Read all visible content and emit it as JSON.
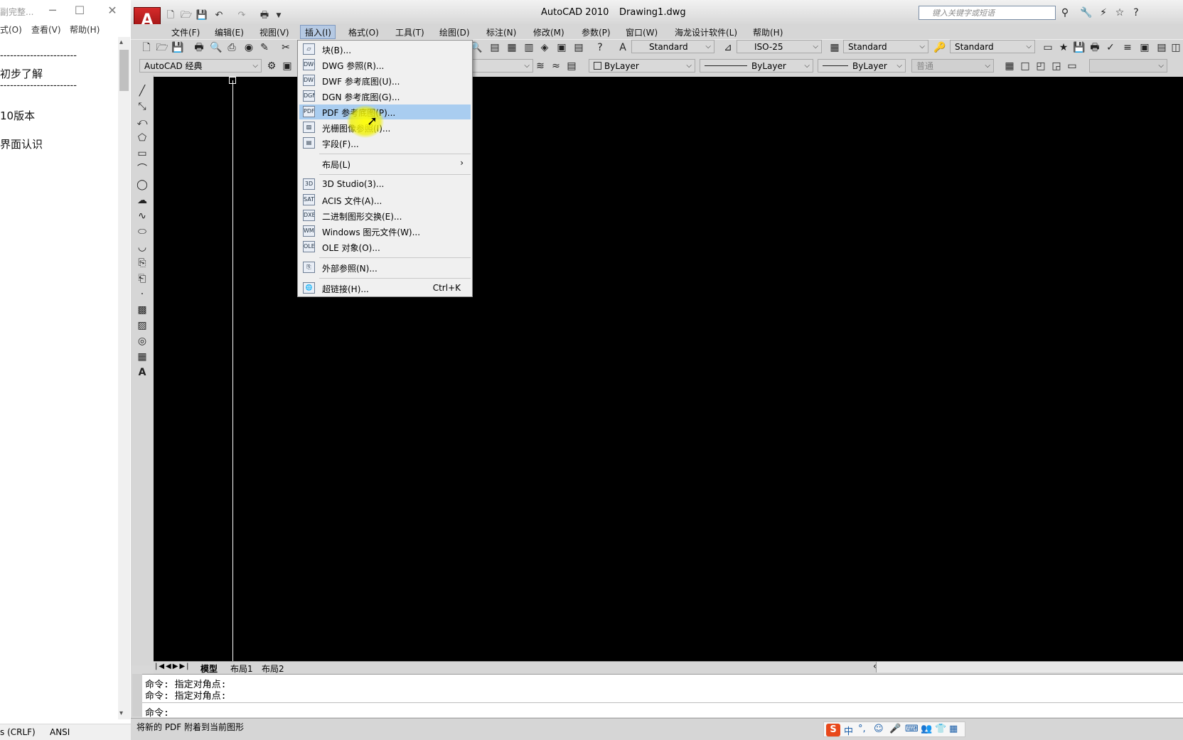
{
  "notepad": {
    "title": "副完整...",
    "menu": [
      "式(O)",
      "查看(V)",
      "帮助(H)"
    ],
    "lines": [
      "-----------------------",
      "初步了解",
      "-----------------------",
      "10版本",
      "界面认识"
    ],
    "status": [
      "s (CRLF)",
      "ANSI"
    ]
  },
  "autocad": {
    "title": "AutoCAD 2010",
    "file": "Drawing1.dwg",
    "search_placeholder": "键入关键字或短语",
    "menus": [
      "文件(F)",
      "编辑(E)",
      "视图(V)",
      "插入(I)",
      "格式(O)",
      "工具(T)",
      "绘图(D)",
      "标注(N)",
      "修改(M)",
      "参数(P)",
      "窗口(W)",
      "海龙设计软件(L)",
      "帮助(H)"
    ],
    "toolbar": {
      "text_style": "Standard",
      "dim_style": "ISO-25",
      "table_style": "Standard",
      "mleader_style": "Standard",
      "workspace": "AutoCAD 经典",
      "layer": "ByLayer",
      "linetype": "ByLayer",
      "lineweight": "ByLayer",
      "plotstyle": "普通"
    },
    "tabs": [
      "模型",
      "布局1",
      "布局2"
    ],
    "command_history": [
      "命令: 指定对角点:",
      "命令: 指定对角点:"
    ],
    "command_prompt": "命令:",
    "status_text": "将新的 PDF 附着到当前图形"
  },
  "insert_menu": {
    "items": [
      {
        "label": "块(B)...",
        "icon": "block-icon"
      },
      {
        "label": "DWG 参照(R)...",
        "icon": "dwg-icon"
      },
      {
        "label": "DWF 参考底图(U)...",
        "icon": "dwf-icon"
      },
      {
        "label": "DGN 参考底图(G)...",
        "icon": "dgn-icon"
      },
      {
        "label": "PDF 参考底图(P)...",
        "icon": "pdf-icon"
      },
      {
        "label": "光栅图像参照(I)...",
        "icon": "raster-image-icon"
      },
      {
        "label": "字段(F)...",
        "icon": "field-icon"
      },
      {
        "label": "布局(L)",
        "icon": "",
        "submenu": true
      },
      {
        "label": "3D Studio(3)...",
        "icon": "3ds-icon"
      },
      {
        "label": "ACIS 文件(A)...",
        "icon": "acis-icon"
      },
      {
        "label": "二进制图形交换(E)...",
        "icon": "dxb-icon"
      },
      {
        "label": "Windows 图元文件(W)...",
        "icon": "wmf-icon"
      },
      {
        "label": "OLE 对象(O)...",
        "icon": "ole-icon"
      },
      {
        "label": "外部参照(N)...",
        "icon": "xref-icon"
      },
      {
        "label": "超链接(H)...",
        "icon": "hyperlink-icon",
        "shortcut": "Ctrl+K"
      }
    ],
    "highlighted_index": 4
  },
  "ime": {
    "items": [
      "中",
      "°,",
      "☺",
      "🎤",
      "⌨",
      "👥",
      "👕",
      "▦"
    ]
  },
  "colors": {
    "menu_highlight": "#a9cdf0",
    "canvas": "#000000",
    "cursor_highlight": "#f0f000"
  }
}
